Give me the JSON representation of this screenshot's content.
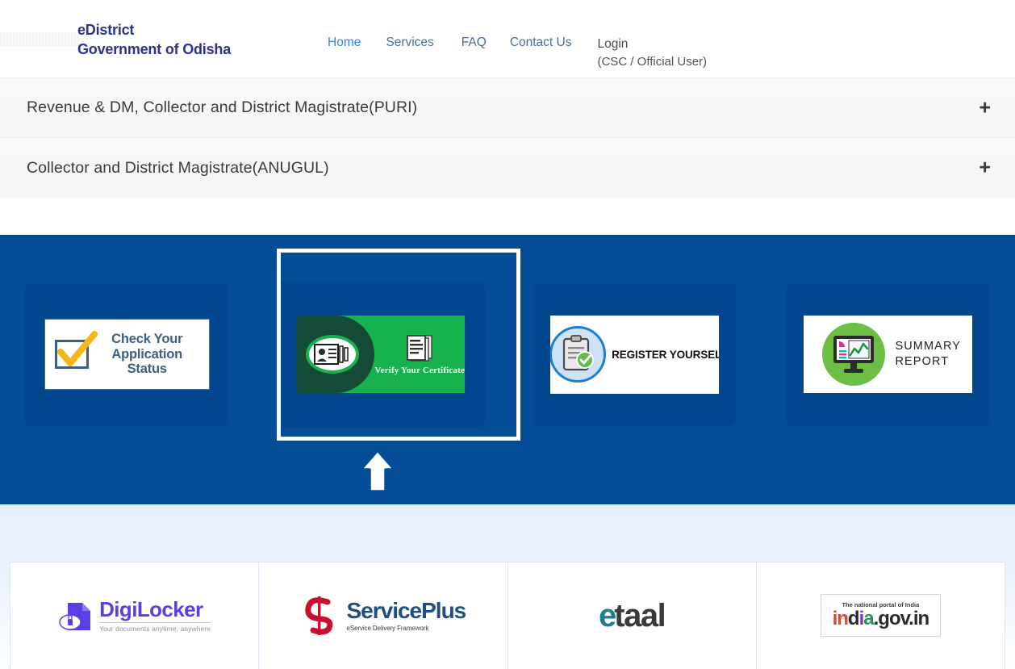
{
  "header": {
    "brand_line1": "eDistrict",
    "brand_line2": "Government of Odisha",
    "logo_placeholder": "odisha-emblem-placeholder",
    "nav": {
      "home": "Home",
      "services": "Services",
      "faq": "FAQ",
      "contact": "Contact Us",
      "login": "Login",
      "login_sub": "(CSC / Official User)"
    },
    "colors": {
      "brand_text": "#2d3191",
      "nav_active": "#2d87f3",
      "nav_link": "#4b6c96",
      "nav_plain": "#4a4a4a"
    }
  },
  "accordion": {
    "items": [
      {
        "title": "Revenue & DM, Collector and District Magistrate(PURI)",
        "toggle": "+"
      },
      {
        "title": "Collector and District Magistrate(ANUGUL)",
        "toggle": "+"
      }
    ]
  },
  "banner": {
    "background_color": "#034c96",
    "tile_color": "#02468d",
    "highlight_color": "#ffffff",
    "selected_index": 1,
    "cursor": "up-arrow-pointer",
    "cards": [
      {
        "name": "check-application-status",
        "title_line1": "Check Your",
        "title_line2": "Application",
        "title_line3": "Status",
        "icon": "checkmark-box-icon",
        "accent": "#f5b718"
      },
      {
        "name": "verify-your-certificate",
        "title": "Verify Your Certificate",
        "icon": "id-card-icon",
        "secondary_icon": "document-stack-icon",
        "accent": "#17b24e",
        "accent_dark": "#144b36"
      },
      {
        "name": "register-yourself",
        "title": "REGISTER YOURSELF",
        "icon": "clipboard-check-icon",
        "accent": "#1b7fd4"
      },
      {
        "name": "summary-report",
        "title_line1": "SUMMARY",
        "title_line2": "REPORT",
        "icon": "monitor-chart-icon",
        "accent": "#6cbe45"
      }
    ]
  },
  "footer_logos": [
    {
      "name": "digilocker",
      "label": "DigiLocker",
      "tagline": "Your documents anytime, anywhere",
      "color": "#5b3fe4"
    },
    {
      "name": "serviceplus",
      "label": "ServicePlus",
      "tagline": "eService Delivery Framework",
      "color": "#1d4f82",
      "mark_color": "#c8102e"
    },
    {
      "name": "etaal",
      "label_part1": "e",
      "label_part2": "taal",
      "color": "#1d7f96"
    },
    {
      "name": "india-gov-in",
      "tagline": "The national portal of India",
      "label": "india.gov.in"
    }
  ]
}
